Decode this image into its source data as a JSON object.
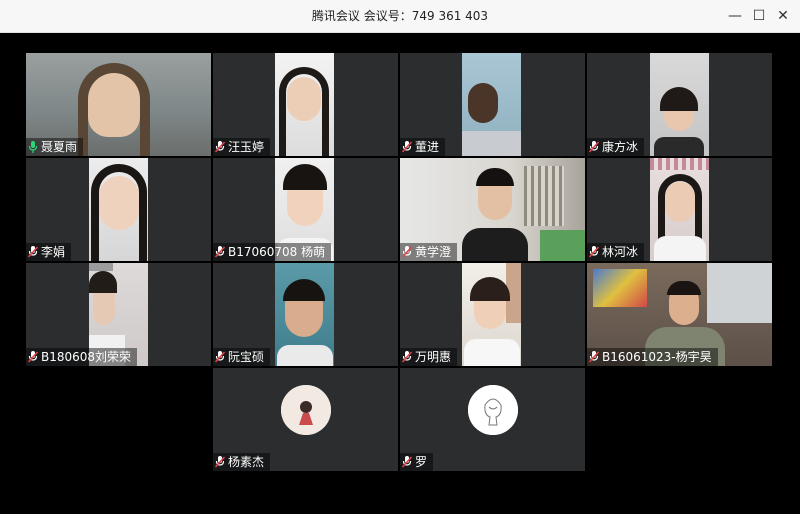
{
  "window": {
    "title": "腾讯会议 会议号：749 361 403",
    "minimize_glyph": "—",
    "maximize_glyph": "☐",
    "close_glyph": "✕"
  },
  "participants": [
    {
      "name": "聂夏雨",
      "mic": "on"
    },
    {
      "name": "汪玉婷",
      "mic": "off"
    },
    {
      "name": "董进",
      "mic": "off"
    },
    {
      "name": "康方冰",
      "mic": "off"
    },
    {
      "name": "李娟",
      "mic": "off"
    },
    {
      "name": "B17060708 杨萌",
      "mic": "off"
    },
    {
      "name": "黄学澄",
      "mic": "off"
    },
    {
      "name": "林河冰",
      "mic": "off"
    },
    {
      "name": "B180608刘荣荣",
      "mic": "off"
    },
    {
      "name": "阮宝硕",
      "mic": "off"
    },
    {
      "name": "万明惠",
      "mic": "off"
    },
    {
      "name": "B16061023-杨宇昊",
      "mic": "off"
    },
    {
      "name": "杨素杰",
      "mic": "off"
    },
    {
      "name": "罗",
      "mic": "off"
    }
  ],
  "colors": {
    "active_speaker_border": "#1fb26a",
    "mic_on": "#2fd47a",
    "mic_off": "#e0424a",
    "tile_bg": "#2b2d2f"
  },
  "icons": {
    "mic_on": "microphone-icon",
    "mic_off": "microphone-muted-icon",
    "avatar_1": "girl-avatar-icon",
    "avatar_2": "sketch-avatar-icon"
  }
}
